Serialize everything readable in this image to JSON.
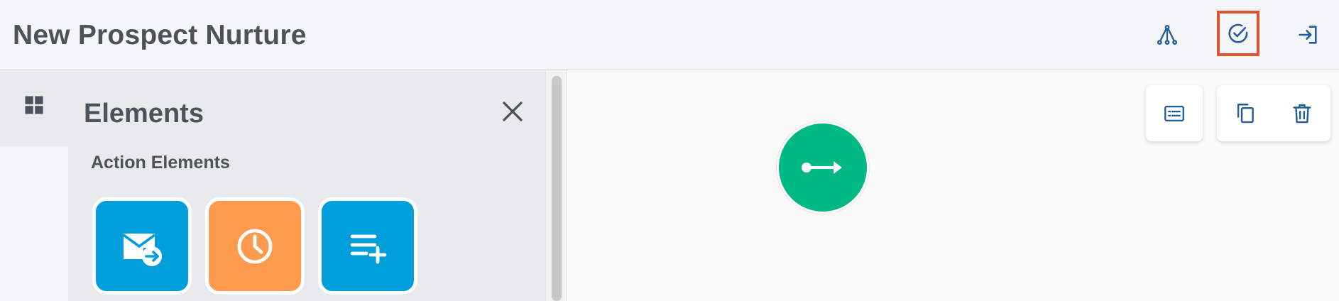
{
  "header": {
    "title": "New Prospect Nurture",
    "buttons": [
      {
        "name": "flow-icon"
      },
      {
        "name": "validate-icon",
        "highlighted": true
      },
      {
        "name": "exit-icon"
      }
    ]
  },
  "sidebar": {
    "rail_icon": "grid-icon",
    "panel_title": "Elements",
    "section_title": "Action Elements",
    "elements": [
      {
        "icon": "send-email-icon",
        "color": "#009fdb"
      },
      {
        "icon": "wait-clock-icon",
        "color": "#fd9a4d"
      },
      {
        "icon": "add-to-list-icon",
        "color": "#009fdb"
      }
    ]
  },
  "canvas": {
    "toolbar": [
      "details-card-icon",
      "duplicate-icon",
      "delete-icon"
    ],
    "start_node": {
      "icon": "start-arrow-icon",
      "color": "#00b883"
    }
  },
  "colors": {
    "accent": "#1f5c99",
    "highlight_border": "#e0532f",
    "title_text": "#4b5259"
  }
}
